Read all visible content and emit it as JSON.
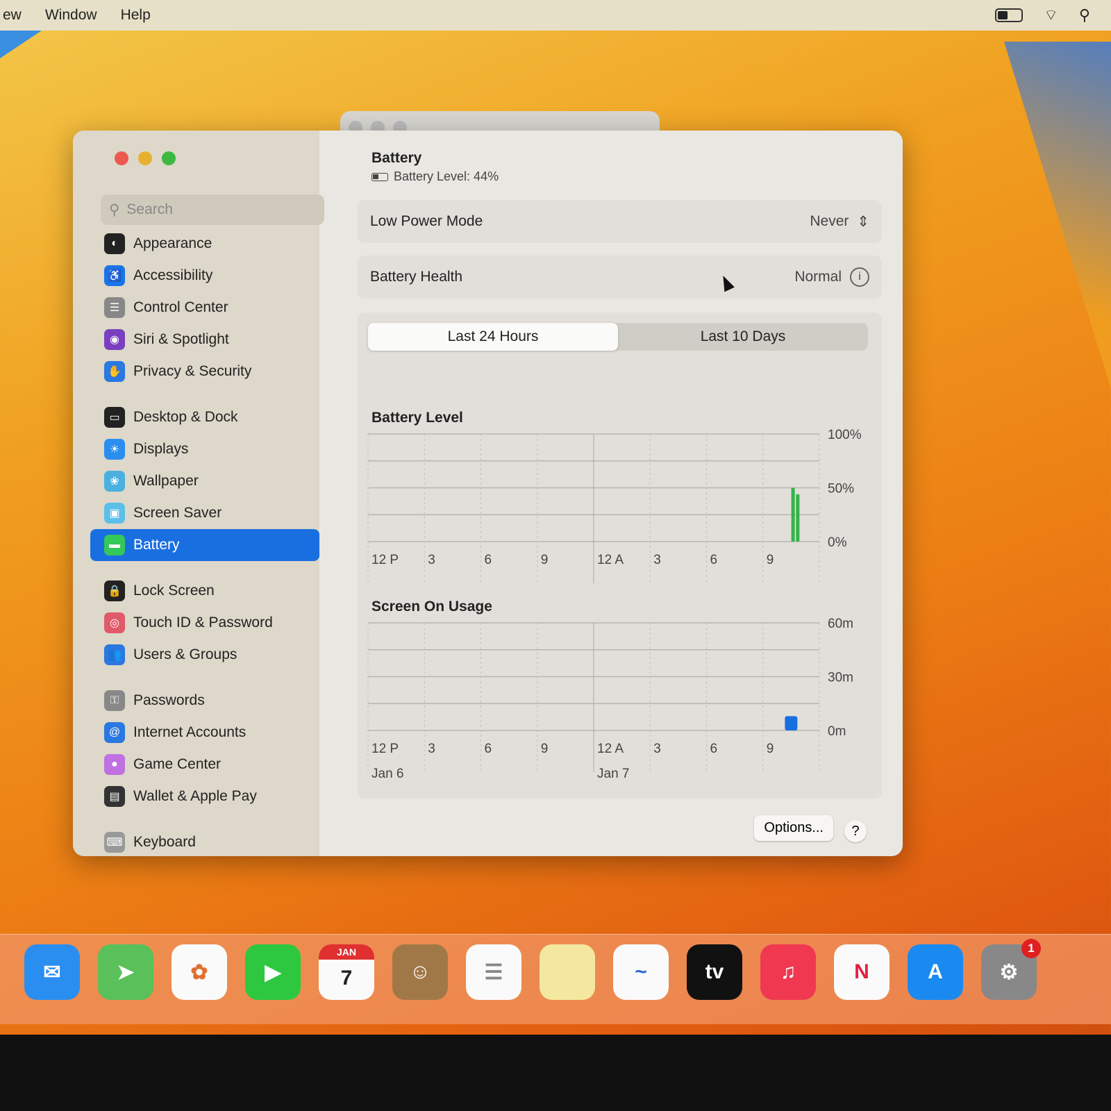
{
  "menubar": {
    "items": [
      "ew",
      "Window",
      "Help"
    ]
  },
  "search": {
    "placeholder": "Search"
  },
  "sidebar": {
    "items": [
      {
        "label": "Appearance",
        "color": "#222",
        "glyph": "◐"
      },
      {
        "label": "Accessibility",
        "color": "#1a73e8",
        "glyph": "♿"
      },
      {
        "label": "Control Center",
        "color": "#888",
        "glyph": "☰"
      },
      {
        "label": "Siri & Spotlight",
        "color": "#7a3fc0",
        "glyph": "◉"
      },
      {
        "label": "Privacy & Security",
        "color": "#2a78e0",
        "glyph": "✋"
      },
      {
        "label": "Desktop & Dock",
        "color": "#222",
        "glyph": "▭",
        "gap": true
      },
      {
        "label": "Displays",
        "color": "#2a8ef0",
        "glyph": "☀"
      },
      {
        "label": "Wallpaper",
        "color": "#4ab0e0",
        "glyph": "❀"
      },
      {
        "label": "Screen Saver",
        "color": "#5ac0e8",
        "glyph": "▣"
      },
      {
        "label": "Battery",
        "color": "#34c759",
        "glyph": "▬",
        "selected": true
      },
      {
        "label": "Lock Screen",
        "color": "#222",
        "glyph": "🔒",
        "gap": true
      },
      {
        "label": "Touch ID & Password",
        "color": "#e05a6a",
        "glyph": "◎"
      },
      {
        "label": "Users & Groups",
        "color": "#2a78e0",
        "glyph": "👥"
      },
      {
        "label": "Passwords",
        "color": "#888",
        "glyph": "⚿",
        "gap": true
      },
      {
        "label": "Internet Accounts",
        "color": "#2a78e0",
        "glyph": "@"
      },
      {
        "label": "Game Center",
        "color": "#c070e0",
        "glyph": "●"
      },
      {
        "label": "Wallet & Apple Pay",
        "color": "#333",
        "glyph": "▤"
      },
      {
        "label": "Keyboard",
        "color": "#999",
        "glyph": "⌨",
        "gap": true
      }
    ]
  },
  "main": {
    "title": "Battery",
    "battery_level": "Battery Level: 44%",
    "low_power_label": "Low Power Mode",
    "low_power_value": "Never",
    "health_label": "Battery Health",
    "health_value": "Normal",
    "tabs": [
      "Last 24 Hours",
      "Last 10 Days"
    ],
    "options": "Options...",
    "help": "?"
  },
  "chart_data": [
    {
      "type": "bar",
      "title": "Battery Level",
      "x_unit": "hours since 12 PM Jan 6",
      "xlim": [
        0,
        24
      ],
      "ylim": [
        0,
        100
      ],
      "ytick_labels": [
        "100%",
        "50%",
        "0%"
      ],
      "yticks": [
        100,
        50,
        0
      ],
      "xtick_labels": [
        "12 P",
        "3",
        "6",
        "9",
        "12 A",
        "3",
        "6",
        "9"
      ],
      "points": [
        {
          "x": 22.6,
          "y": 50
        },
        {
          "x": 22.85,
          "y": 44
        }
      ],
      "color": "#34b34a"
    },
    {
      "type": "bar",
      "title": "Screen On Usage",
      "x_unit": "hours since 12 PM Jan 6",
      "xlim": [
        0,
        24
      ],
      "ylim": [
        0,
        60
      ],
      "ytick_labels": [
        "60m",
        "30m",
        "0m"
      ],
      "yticks": [
        60,
        30,
        0
      ],
      "xtick_labels": [
        "12 P",
        "3",
        "6",
        "9",
        "12 A",
        "3",
        "6",
        "9"
      ],
      "date_labels": [
        "Jan 6",
        "Jan 7"
      ],
      "points": [
        {
          "x": 22.5,
          "y": 8
        }
      ],
      "color": "#1a6fe0"
    }
  ],
  "dock": {
    "items": [
      {
        "name": "mail",
        "glyph": "✉",
        "bg": "#2a8ef0"
      },
      {
        "name": "maps",
        "glyph": "➤",
        "bg": "#5ac05a"
      },
      {
        "name": "photos",
        "glyph": "✿",
        "bg": "#fafafa",
        "fg": "#e07030"
      },
      {
        "name": "facetime",
        "glyph": "▶",
        "bg": "#2ec840"
      },
      {
        "name": "calendar",
        "glyph": "7",
        "bg": "#fafafa",
        "fg": "#222",
        "top": "JAN"
      },
      {
        "name": "contacts",
        "glyph": "☺",
        "bg": "#a07848"
      },
      {
        "name": "reminders",
        "glyph": "☰",
        "bg": "#fafafa",
        "fg": "#888"
      },
      {
        "name": "notes",
        "glyph": "",
        "bg": "#f4e8a0"
      },
      {
        "name": "freeform",
        "glyph": "~",
        "bg": "#fafafa",
        "fg": "#2a6ad0"
      },
      {
        "name": "tv",
        "glyph": "tv",
        "bg": "#111"
      },
      {
        "name": "music",
        "glyph": "♫",
        "bg": "#f03850"
      },
      {
        "name": "news",
        "glyph": "N",
        "bg": "#fafafa",
        "fg": "#e02040"
      },
      {
        "name": "app-store",
        "glyph": "A",
        "bg": "#1a8af0"
      },
      {
        "name": "system-settings",
        "glyph": "⚙",
        "bg": "#888",
        "badge": "1"
      }
    ]
  }
}
